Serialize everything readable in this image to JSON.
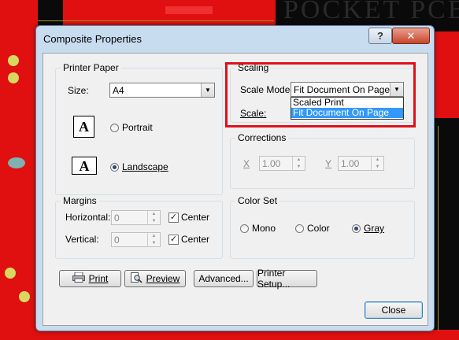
{
  "window": {
    "title": "Composite Properties",
    "help_label": "?",
    "close_label": "✕"
  },
  "background_text": "POCKET PCB",
  "printer_paper": {
    "legend": "Printer Paper",
    "size_label": "Size:",
    "size_value": "A4",
    "portrait_label": "Portrait",
    "landscape_label": "Landscape",
    "orientation_selected": "Landscape",
    "page_icon_letter": "A"
  },
  "scaling": {
    "legend": "Scaling",
    "scale_mode_label": "Scale Mode",
    "scale_mode_value": "Fit Document On Page",
    "scale_label": "Scale:",
    "options": [
      "Scaled Print",
      "Fit Document On Page"
    ],
    "selected_option": "Fit Document On Page"
  },
  "corrections": {
    "legend": "Corrections",
    "x_label": "X",
    "x_value": "1.00",
    "y_label": "Y",
    "y_value": "1.00"
  },
  "margins": {
    "legend": "Margins",
    "horizontal_label": "Horizontal:",
    "horizontal_value": "0",
    "vertical_label": "Vertical:",
    "vertical_value": "0",
    "center_label": "Center",
    "horizontal_center_checked": true,
    "vertical_center_checked": true
  },
  "color_set": {
    "legend": "Color Set",
    "mono_label": "Mono",
    "color_label": "Color",
    "gray_label": "Gray",
    "selected": "Gray"
  },
  "buttons": {
    "print": "Print",
    "preview": "Preview",
    "advanced": "Advanced...",
    "printer_setup": "Printer Setup...",
    "close": "Close"
  },
  "colors": {
    "highlight": "#3399ff",
    "annotation_box": "#e0101a",
    "pcb_red": "#e01010"
  }
}
